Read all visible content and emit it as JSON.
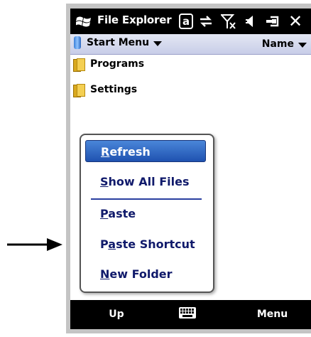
{
  "titlebar": {
    "app_icon": "windows-flag-icon",
    "title": "File Explorer",
    "status_icons": [
      "at-sign-icon",
      "sync-arrows-icon",
      "signal-off-icon",
      "speaker-icon",
      "battery-icon",
      "close-icon"
    ],
    "at_glyph": "a",
    "close_glyph": "✕"
  },
  "location": {
    "folder": "Start Menu",
    "sort": "Name"
  },
  "files": [
    {
      "name": "Programs",
      "icon": "folder-icon"
    },
    {
      "name": "Settings",
      "icon": "folder-icon"
    }
  ],
  "context_menu": {
    "items": [
      {
        "label": "Refresh",
        "mnemonic": "R",
        "rest": "efresh",
        "selected": true
      },
      {
        "label": "Show All Files",
        "mnemonic": "S",
        "rest": "how All Files",
        "selected": false
      },
      {
        "label": "Paste",
        "mnemonic": "P",
        "rest": "aste",
        "selected": false
      },
      {
        "label": "Paste Shortcut",
        "pre": "P",
        "mnemonic": "a",
        "rest": "ste Shortcut",
        "selected": false
      },
      {
        "label": "New Folder",
        "mnemonic": "N",
        "rest": "ew Folder",
        "selected": false
      }
    ]
  },
  "softkeys": {
    "left": "Up",
    "center_icon": "keyboard-icon",
    "right": "Menu"
  },
  "colors": {
    "titlebar_bg": "#000000",
    "menu_highlight": "#2f66c4",
    "menu_text": "#101a6b",
    "device_frame": "#c4c4c4"
  },
  "annotation": {
    "arrow_icon": "right-arrow-icon"
  }
}
